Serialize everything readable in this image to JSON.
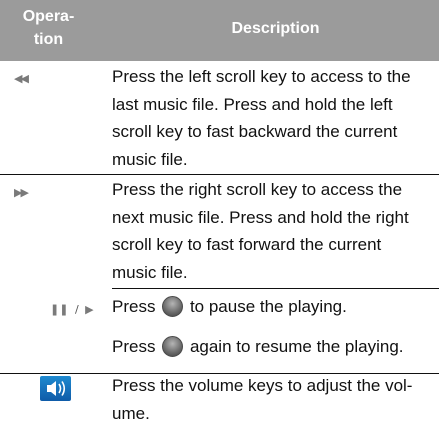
{
  "table": {
    "header": {
      "operation": "Opera-\ntion",
      "description": "Description"
    },
    "rows": [
      {
        "icon": "rewind-icon",
        "icon_glyph": "◀◀",
        "description_lines": [
          "Press the left scroll key to access to the",
          "last music file. Press and hold the left",
          "scroll key to fast backward the current",
          "music file."
        ]
      },
      {
        "icon": "fast-forward-icon",
        "icon_glyph": "▶▶",
        "description_lines": [
          "Press the right scroll key to access the",
          "next music file. Press and hold the right",
          "scroll key to fast forward the current",
          "music file."
        ]
      },
      {
        "icon": "play-pause-icon",
        "icon_glyph_pause": "❚❚",
        "icon_separator": "/",
        "icon_glyph_play": "▶",
        "line1_before": "Press",
        "line1_after": "to pause the playing.",
        "line2_before": "Press",
        "line2_after": "again to resume the playing."
      },
      {
        "icon": "volume-icon",
        "description_lines": [
          "Press the volume keys to adjust the vol-",
          "ume."
        ]
      }
    ]
  },
  "colors": {
    "header_bg": "#9b9b9b",
    "header_text": "#ffffff",
    "icon_gray": "#7a7a7a",
    "volume_blue": "#1e8ad0"
  }
}
